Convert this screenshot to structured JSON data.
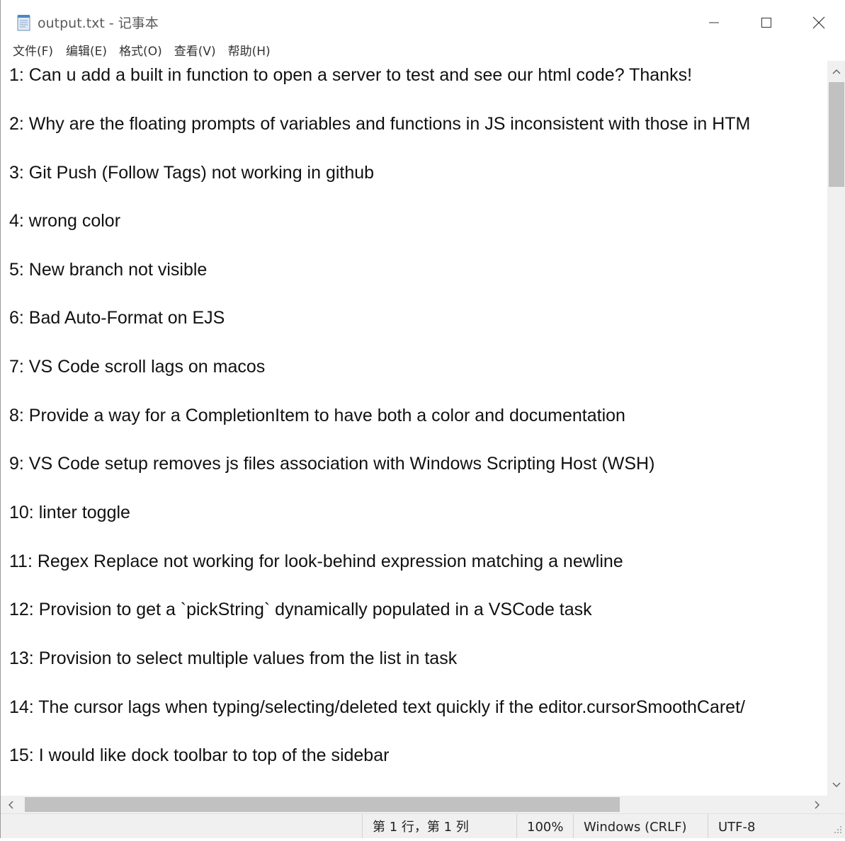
{
  "window": {
    "title": "output.txt - 记事本",
    "icon": "notepad-icon"
  },
  "menu": {
    "items": [
      {
        "label": "文件(F)"
      },
      {
        "label": "编辑(E)"
      },
      {
        "label": "格式(O)"
      },
      {
        "label": "查看(V)"
      },
      {
        "label": "帮助(H)"
      }
    ]
  },
  "editor": {
    "lines": [
      "1: Can u add a built in function to open a server to test and see our html code? Thanks!",
      "2: Why are the floating prompts of variables and functions in JS inconsistent with those in HTM",
      "3: Git Push (Follow Tags) not working in github",
      "4: wrong color",
      "5: New branch not visible",
      "6: Bad Auto-Format on EJS",
      "7: VS Code scroll lags on macos",
      "8: Provide a way for a CompletionItem to have both a color and documentation",
      "9: VS Code setup removes js files association  with Windows Scripting Host (WSH)",
      "10: linter toggle",
      "11: Regex Replace not working for look-behind expression matching a newline",
      "12: Provision to get a `pickString` dynamically populated in a VSCode task",
      "13: Provision to select multiple values from the list in task",
      "14: The cursor lags when typing/selecting/deleted text quickly if the editor.cursorSmoothCaret/",
      "15: I would like dock toolbar to top of the sidebar"
    ]
  },
  "status": {
    "position": "第 1 行，第 1 列",
    "zoom": "100%",
    "line_ending": "Windows (CRLF)",
    "encoding": "UTF-8"
  }
}
